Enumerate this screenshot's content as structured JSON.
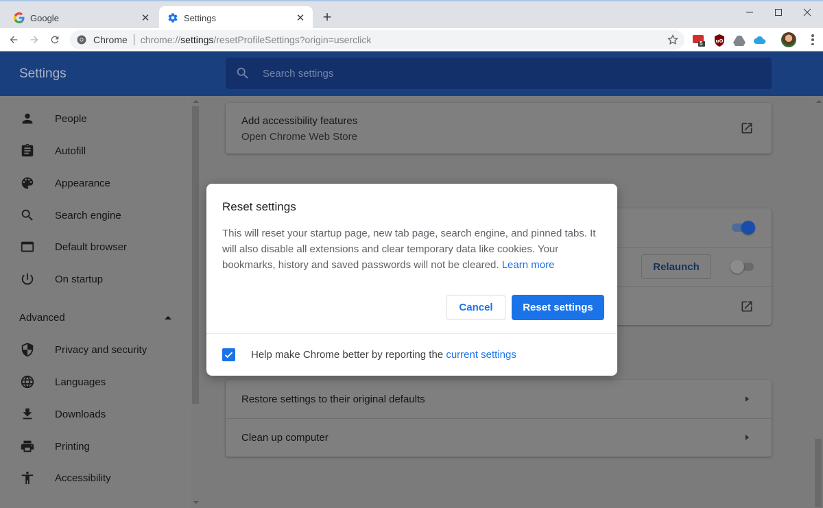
{
  "browser": {
    "tabs": [
      {
        "title": "Google",
        "active": false,
        "icon": "google-g-icon"
      },
      {
        "title": "Settings",
        "active": true,
        "icon": "settings-gear-icon"
      }
    ],
    "omnibox": {
      "chip": "Chrome",
      "scheme": "chrome://",
      "host": "settings",
      "path": "/resetProfileSettings?origin=userclick"
    },
    "extensions": {
      "badge_count": "5"
    }
  },
  "settings": {
    "header_title": "Settings",
    "search_placeholder": "Search settings",
    "sidebar": {
      "items": [
        {
          "label": "People",
          "icon": "person-icon"
        },
        {
          "label": "Autofill",
          "icon": "clipboard-icon"
        },
        {
          "label": "Appearance",
          "icon": "palette-icon"
        },
        {
          "label": "Search engine",
          "icon": "search-icon"
        },
        {
          "label": "Default browser",
          "icon": "browser-window-icon"
        },
        {
          "label": "On startup",
          "icon": "power-icon"
        }
      ],
      "advanced_label": "Advanced",
      "advanced_items": [
        {
          "label": "Privacy and security",
          "icon": "shield-icon"
        },
        {
          "label": "Languages",
          "icon": "globe-icon"
        },
        {
          "label": "Downloads",
          "icon": "download-icon"
        },
        {
          "label": "Printing",
          "icon": "printer-icon"
        },
        {
          "label": "Accessibility",
          "icon": "accessibility-icon"
        }
      ]
    },
    "main": {
      "accessibility_card": {
        "title": "Add accessibility features",
        "subtitle": "Open Chrome Web Store"
      },
      "system_card": {
        "relaunch_label": "Relaunch",
        "toggle1_on": true,
        "toggle2_on": false
      },
      "reset_card": {
        "rows": [
          {
            "label": "Restore settings to their original defaults"
          },
          {
            "label": "Clean up computer"
          }
        ]
      }
    }
  },
  "dialog": {
    "title": "Reset settings",
    "body": "This will reset your startup page, new tab page, search engine, and pinned tabs. It will also disable all extensions and clear temporary data like cookies. Your bookmarks, history and saved passwords will not be cleared.",
    "learn_more": "Learn more",
    "cancel_label": "Cancel",
    "confirm_label": "Reset settings",
    "footer_text": "Help make Chrome better by reporting the",
    "footer_link": "current settings",
    "checkbox_checked": true
  },
  "colors": {
    "accent": "#1a73e8",
    "header_bg": "#1a3f7e"
  }
}
